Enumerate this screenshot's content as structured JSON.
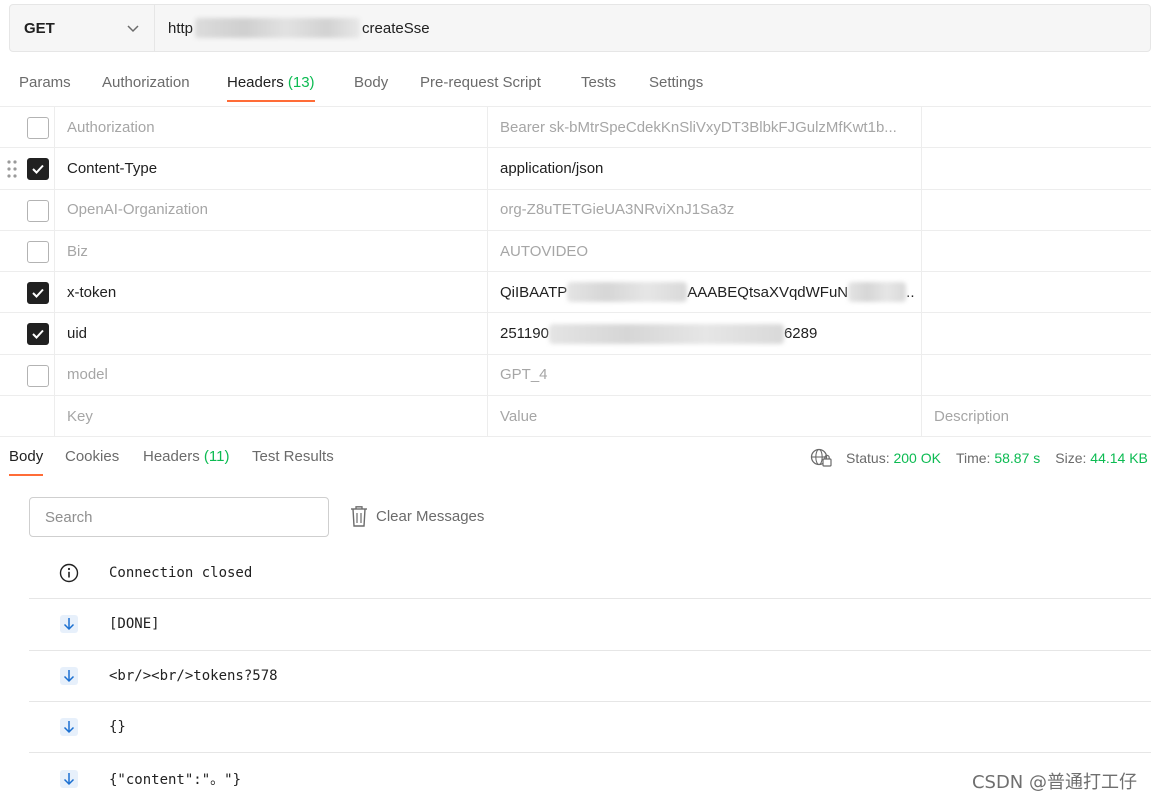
{
  "request": {
    "method": "GET",
    "url_prefix": "http",
    "url_suffix": "createSse"
  },
  "request_tabs": [
    {
      "label": "Params",
      "count": ""
    },
    {
      "label": "Authorization",
      "count": ""
    },
    {
      "label": "Headers ",
      "count": "(13)",
      "active": true
    },
    {
      "label": "Body",
      "count": ""
    },
    {
      "label": "Pre-request Script",
      "count": ""
    },
    {
      "label": "Tests",
      "count": ""
    },
    {
      "label": "Settings",
      "count": ""
    }
  ],
  "headers": {
    "rows": [
      {
        "checked": false,
        "key": "Authorization",
        "value": "Bearer sk-bMtrSpeCdekKnSliVxyDT3BlbkFJGulzMfKwt1b..."
      },
      {
        "checked": true,
        "key": "Content-Type",
        "value": "application/json"
      },
      {
        "checked": false,
        "key": "OpenAI-Organization",
        "value": "org-Z8uTETGieUA3NRviXnJ1Sa3z"
      },
      {
        "checked": false,
        "key": "Biz",
        "value": "AUTOVIDEO"
      },
      {
        "checked": true,
        "key": "x-token",
        "value_start": "QiIBAATP",
        "value_mid": "AAABEQtsaXVqdWFuN",
        "value_end": ".."
      },
      {
        "checked": true,
        "key": "uid",
        "value_start": "251190",
        "value_end": "6289"
      },
      {
        "checked": false,
        "key": "model",
        "value": "GPT_4"
      }
    ],
    "placeholder": {
      "key": "Key",
      "value": "Value",
      "description": "Description"
    }
  },
  "response_tabs": [
    {
      "label": "Body",
      "count": "",
      "active": true
    },
    {
      "label": "Cookies",
      "count": ""
    },
    {
      "label": "Headers ",
      "count": "(11)"
    },
    {
      "label": "Test Results",
      "count": ""
    }
  ],
  "status": {
    "status_label": "Status:",
    "status_value": "200 OK",
    "time_label": "Time:",
    "time_value": "58.87 s",
    "size_label": "Size:",
    "size_value": "44.14 KB"
  },
  "search": {
    "placeholder": "Search"
  },
  "clear_label": "Clear Messages",
  "messages": [
    {
      "icon": "info-icon",
      "text": "Connection closed"
    },
    {
      "icon": "arrow-down-icon",
      "text": "[DONE]"
    },
    {
      "icon": "arrow-down-icon",
      "text": "<br/><br/>tokens?578"
    },
    {
      "icon": "arrow-down-icon",
      "text": "{}"
    },
    {
      "icon": "arrow-down-icon",
      "text": "{\"content\":\"。\"}"
    }
  ],
  "watermark": "CSDN @普通打工仔",
  "colors": {
    "accent": "#ff6c37",
    "success": "#0cbb52"
  }
}
